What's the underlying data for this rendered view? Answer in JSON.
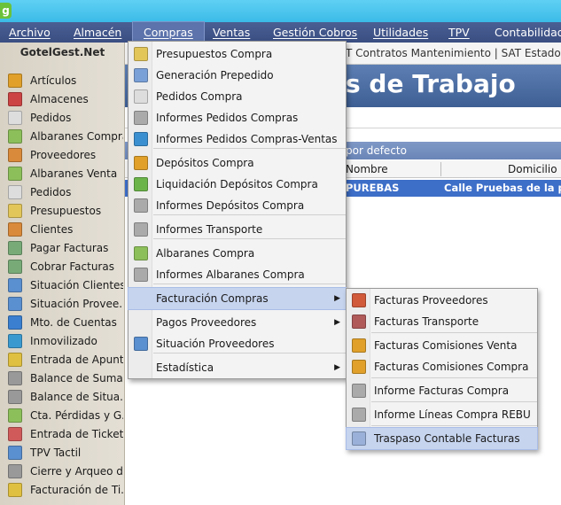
{
  "app": {
    "logo_letter": "g"
  },
  "menubar": {
    "items": [
      {
        "label": "Archivo",
        "active": false
      },
      {
        "label": "Almacén",
        "active": false
      },
      {
        "label": "Compras",
        "active": true
      },
      {
        "label": "Ventas",
        "active": false
      },
      {
        "label": "Gestión Cobros",
        "active": false
      },
      {
        "label": "Utilidades",
        "active": false
      },
      {
        "label": "TPV",
        "active": false
      },
      {
        "label": "Contabilidad",
        "active": false
      }
    ]
  },
  "sidebar": {
    "title": "GotelGest.Net",
    "items": [
      {
        "label": "Artículos",
        "icon": "box-icon",
        "color": "#e0a02a"
      },
      {
        "label": "Almacenes",
        "icon": "warehouse-icon",
        "color": "#c44"
      },
      {
        "label": "Pedidos",
        "icon": "document-icon",
        "color": "#ddd"
      },
      {
        "label": "Albaranes Compra",
        "icon": "document-icon",
        "color": "#8cbf5a"
      },
      {
        "label": "Proveedores",
        "icon": "user-icon",
        "color": "#d98a3a"
      },
      {
        "label": "Albaranes Venta",
        "icon": "document-icon",
        "color": "#8cbf5a"
      },
      {
        "label": "Pedidos",
        "icon": "document-icon",
        "color": "#ddd"
      },
      {
        "label": "Presupuestos",
        "icon": "document-icon",
        "color": "#e3c65a"
      },
      {
        "label": "Clientes",
        "icon": "user-icon",
        "color": "#d98a3a"
      },
      {
        "label": "Pagar Facturas",
        "icon": "cash-icon",
        "color": "#7a7"
      },
      {
        "label": "Cobrar Facturas",
        "icon": "cash-icon",
        "color": "#7a7"
      },
      {
        "label": "Situación Clientes",
        "icon": "user-icon",
        "color": "#5a8fd0"
      },
      {
        "label": "Situación Provee...",
        "icon": "user-icon",
        "color": "#5a8fd0"
      },
      {
        "label": "Mto. de Cuentas",
        "icon": "database-icon",
        "color": "#3a7fd0"
      },
      {
        "label": "Inmovilizado",
        "icon": "globe-icon",
        "color": "#3a9ad0"
      },
      {
        "label": "Entrada de Apunt...",
        "icon": "pencil-icon",
        "color": "#e0c040"
      },
      {
        "label": "Balance de Suma...",
        "icon": "calculator-icon",
        "color": "#999"
      },
      {
        "label": "Balance de Situa...",
        "icon": "calculator-icon",
        "color": "#999"
      },
      {
        "label": "Cta. Pérdidas y G...",
        "icon": "report-icon",
        "color": "#8cbf5a"
      },
      {
        "label": "Entrada de Tickets",
        "icon": "pencil-icon",
        "color": "#d05a5a"
      },
      {
        "label": "TPV Tactil",
        "icon": "terminal-icon",
        "color": "#5a8fd0"
      },
      {
        "label": "Cierre y Arqueo d...",
        "icon": "cashbox-icon",
        "color": "#999"
      },
      {
        "label": "Facturación de Ti...",
        "icon": "invoice-icon",
        "color": "#e0c040"
      }
    ]
  },
  "main": {
    "tabs_text": "T Contratos Mantenimiento | SAT Estados de Avi",
    "banner_title": "s de Trabajo",
    "group_label": "por defecto",
    "columns": [
      "Nombre",
      "Domicilio"
    ],
    "row": {
      "nombre": "PUREBAS",
      "domicilio": "Calle Pruebas de la prue"
    }
  },
  "compras_menu": {
    "items": [
      {
        "label": "Presupuestos Compra",
        "icon": "document-icon",
        "color": "#e3c65a",
        "submenu": false
      },
      {
        "label": "Generación Prepedido",
        "icon": "document-gear-icon",
        "color": "#7aa0d8",
        "submenu": false
      },
      {
        "label": "Pedidos Compra",
        "icon": "document-icon",
        "color": "#ddd",
        "submenu": false
      },
      {
        "label": "Informes Pedidos Compras",
        "icon": "printer-icon",
        "color": "#aaa",
        "submenu": false
      },
      {
        "label": "Informes Pedidos Compras-Ventas",
        "icon": "network-icon",
        "color": "#3a8fd0",
        "submenu": false
      },
      {
        "label": "Depósitos Compra",
        "icon": "deposit-icon",
        "color": "#e0a02a",
        "submenu": false
      },
      {
        "label": "Liquidación Depósitos Compra",
        "icon": "deposit-check-icon",
        "color": "#6bb44a",
        "submenu": false
      },
      {
        "label": "Informes Depósitos Compra",
        "icon": "printer-icon",
        "color": "#aaa",
        "submenu": false
      },
      {
        "label": "Informes Transporte",
        "icon": "printer-icon",
        "color": "#aaa",
        "submenu": false
      },
      {
        "label": "Albaranes Compra",
        "icon": "document-icon",
        "color": "#8cbf5a",
        "submenu": false
      },
      {
        "label": "Informes Albaranes Compra",
        "icon": "printer-icon",
        "color": "#aaa",
        "submenu": false
      },
      {
        "label": "Facturación Compras",
        "icon": "",
        "color": "",
        "submenu": true
      },
      {
        "label": "Pagos Proveedores",
        "icon": "",
        "color": "",
        "submenu": true
      },
      {
        "label": "Situación Proveedores",
        "icon": "user-icon",
        "color": "#5a8fd0",
        "submenu": false
      },
      {
        "label": "Estadística",
        "icon": "",
        "color": "",
        "submenu": true
      }
    ]
  },
  "facturacion_submenu": {
    "items": [
      {
        "label": "Facturas Proveedores",
        "icon": "invoice-red-icon",
        "color": "#d05a3a"
      },
      {
        "label": "Facturas Transporte",
        "icon": "truck-icon",
        "color": "#b05a5a"
      },
      {
        "label": "Facturas Comisiones Venta",
        "icon": "commission-icon",
        "color": "#e0a02a"
      },
      {
        "label": "Facturas Comisiones Compra",
        "icon": "commission-icon",
        "color": "#e0a02a"
      },
      {
        "label": "Informe Facturas Compra",
        "icon": "printer-icon",
        "color": "#aaa"
      },
      {
        "label": "Informe Líneas Compra REBU",
        "icon": "printer-icon",
        "color": "#aaa"
      },
      {
        "label": "Traspaso Contable Facturas",
        "icon": "transfer-icon",
        "color": "#9ab0d8"
      }
    ]
  }
}
